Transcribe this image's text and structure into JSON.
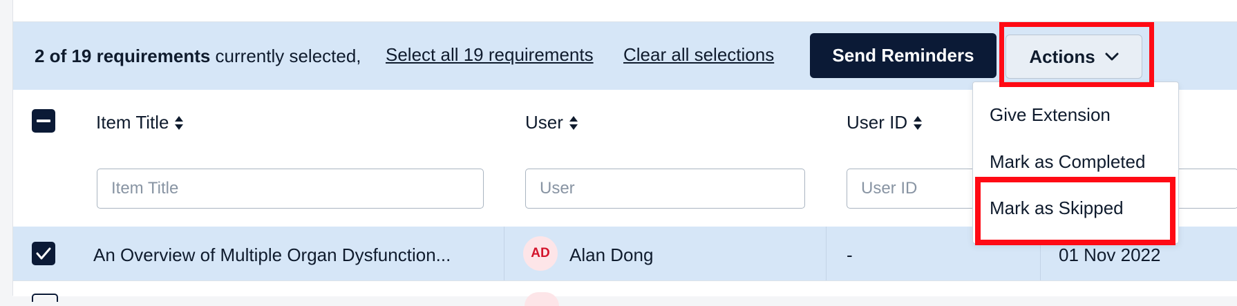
{
  "selection_bar": {
    "count_bold": "2 of 19 requirements",
    "count_rest": " currently selected,",
    "select_all_link": "Select all 19 requirements",
    "clear_link": "Clear all selections",
    "send_reminders_label": "Send Reminders",
    "actions_label": "Actions"
  },
  "actions_menu": {
    "items": [
      "Give Extension",
      "Mark as Completed",
      "Mark as Skipped"
    ]
  },
  "table": {
    "columns": [
      {
        "title": "Item Title",
        "placeholder": "Item Title"
      },
      {
        "title": "User",
        "placeholder": "User"
      },
      {
        "title": "User ID",
        "placeholder": "User ID"
      }
    ],
    "rows": [
      {
        "checked": true,
        "item_title": "An Overview of Multiple Organ Dysfunction...",
        "user_initials": "AD",
        "user_name": "Alan Dong",
        "user_id": "-",
        "date": "01 Nov 2022"
      }
    ]
  },
  "colors": {
    "primary_dark": "#0b1a36",
    "selection_bg": "#d6e6f7",
    "highlight": "#ff0a14",
    "avatar_text": "#d3142c"
  }
}
